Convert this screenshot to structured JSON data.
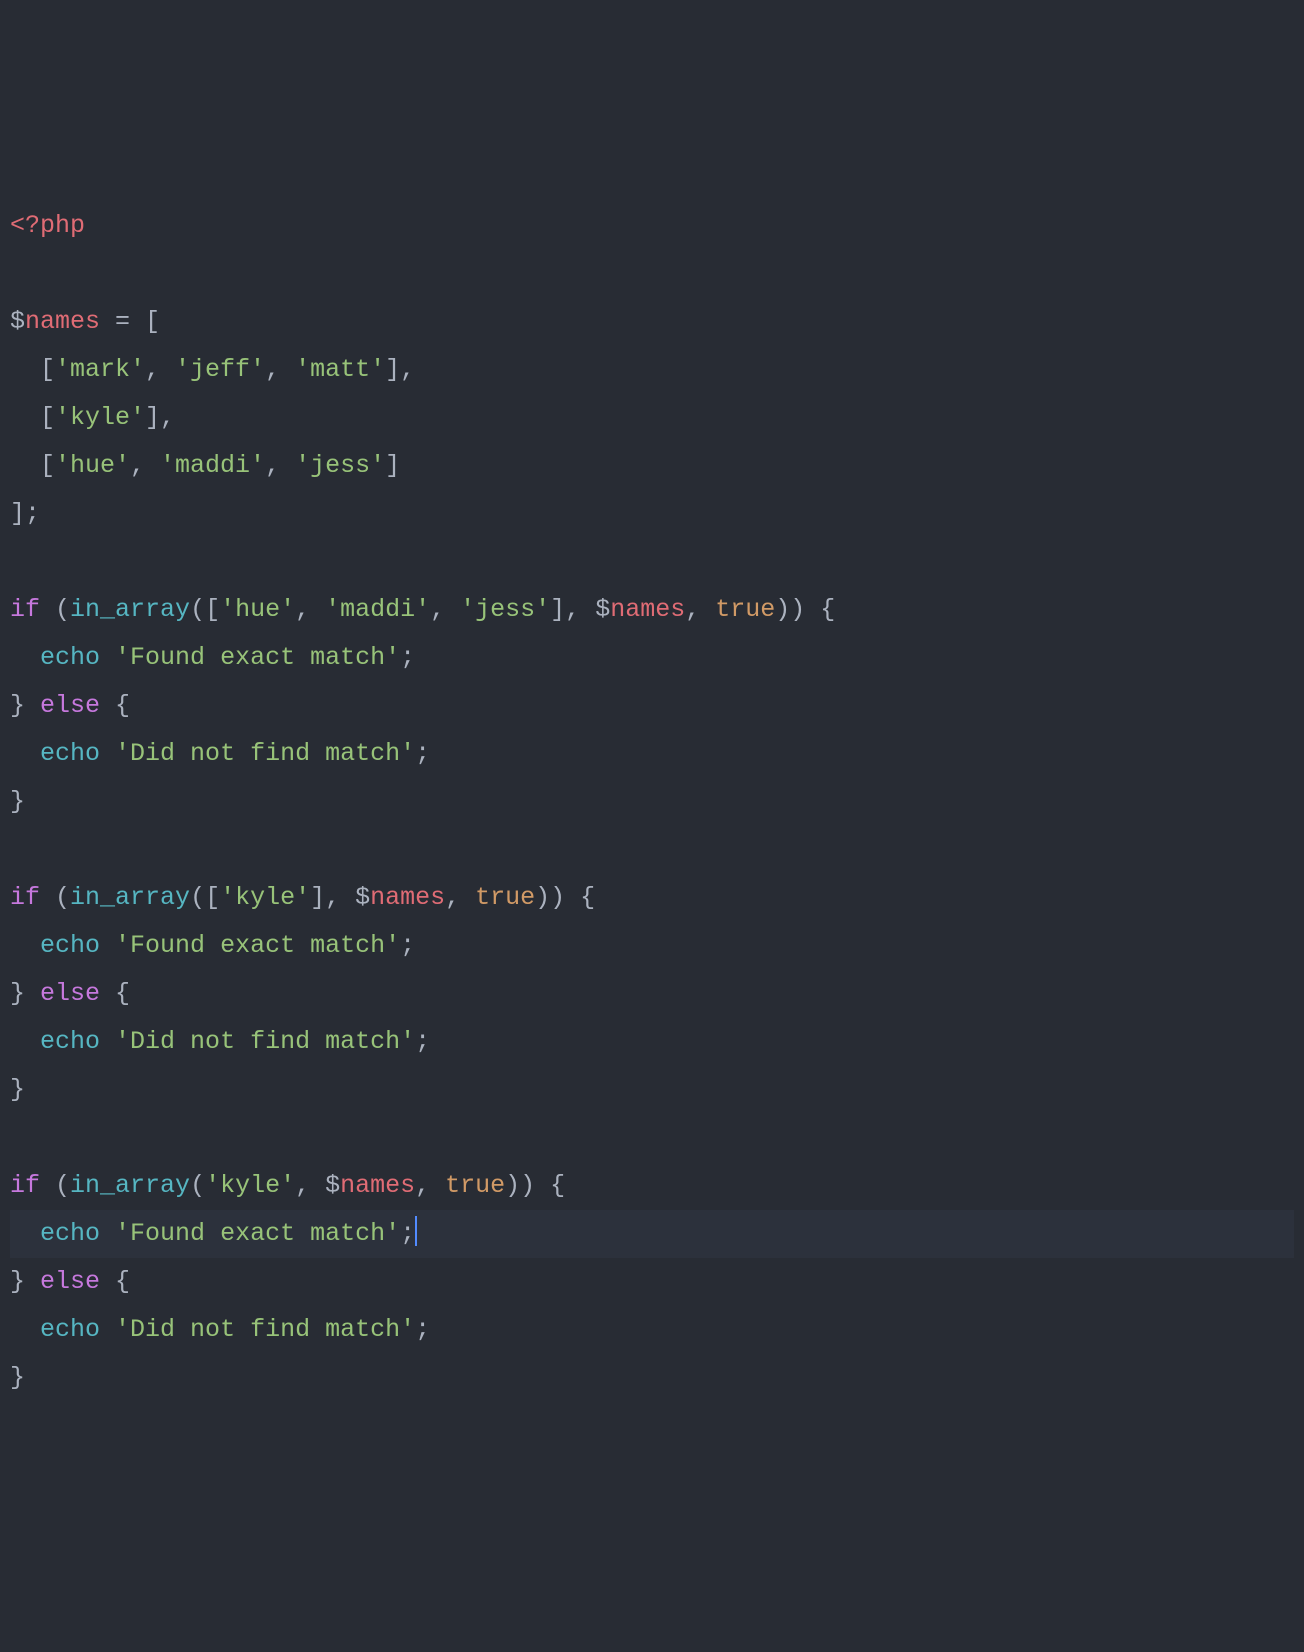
{
  "code": {
    "line1": {
      "phpOpen": "<?php"
    },
    "line3": {
      "sigil": "$",
      "var": "names",
      "assign": " = ["
    },
    "line4": {
      "indent": "  [",
      "s1": "'mark'",
      "c1": ", ",
      "s2": "'jeff'",
      "c2": ", ",
      "s3": "'matt'",
      "end": "],"
    },
    "line5": {
      "indent": "  [",
      "s1": "'kyle'",
      "end": "],"
    },
    "line6": {
      "indent": "  [",
      "s1": "'hue'",
      "c1": ", ",
      "s2": "'maddi'",
      "c2": ", ",
      "s3": "'jess'",
      "end": "]"
    },
    "line7": {
      "close": "];"
    },
    "line9": {
      "kw": "if",
      "sp": " (",
      "fn": "in_array",
      "op": "([",
      "s1": "'hue'",
      "c1": ", ",
      "s2": "'maddi'",
      "c2": ", ",
      "s3": "'jess'",
      "cb": "], ",
      "sigil": "$",
      "var": "names",
      "c3": ", ",
      "bool": "true",
      "end": ")) {"
    },
    "line10": {
      "indent": "  ",
      "fn": "echo",
      "sp": " ",
      "str": "'Found exact match'",
      "end": ";"
    },
    "line11": {
      "close": "} ",
      "kw": "else",
      "open": " {"
    },
    "line12": {
      "indent": "  ",
      "fn": "echo",
      "sp": " ",
      "str": "'Did not find match'",
      "end": ";"
    },
    "line13": {
      "close": "}"
    },
    "line15": {
      "kw": "if",
      "sp": " (",
      "fn": "in_array",
      "op": "([",
      "s1": "'kyle'",
      "cb": "], ",
      "sigil": "$",
      "var": "names",
      "c3": ", ",
      "bool": "true",
      "end": ")) {"
    },
    "line16": {
      "indent": "  ",
      "fn": "echo",
      "sp": " ",
      "str": "'Found exact match'",
      "end": ";"
    },
    "line17": {
      "close": "} ",
      "kw": "else",
      "open": " {"
    },
    "line18": {
      "indent": "  ",
      "fn": "echo",
      "sp": " ",
      "str": "'Did not find match'",
      "end": ";"
    },
    "line19": {
      "close": "}"
    },
    "line21": {
      "kw": "if",
      "sp": " (",
      "fn": "in_array",
      "op": "(",
      "s1": "'kyle'",
      "cb": ", ",
      "sigil": "$",
      "var": "names",
      "c3": ", ",
      "bool": "true",
      "end": ")) {"
    },
    "line22": {
      "indent": "  ",
      "fn": "echo",
      "sp": " ",
      "str": "'Found exact match'",
      "end": ";"
    },
    "line23": {
      "close": "} ",
      "kw": "else",
      "open": " {"
    },
    "line24": {
      "indent": "  ",
      "fn": "echo",
      "sp": " ",
      "str": "'Did not find match'",
      "end": ";"
    },
    "line25": {
      "close": "}"
    }
  }
}
